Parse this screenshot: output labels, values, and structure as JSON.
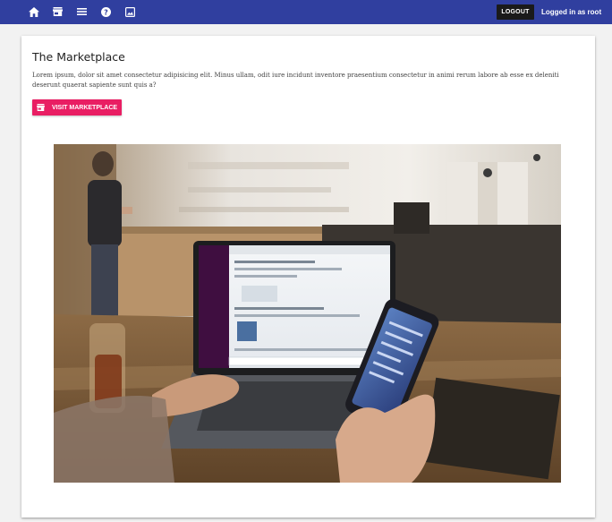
{
  "nav": {
    "icons": [
      "home-icon",
      "store-icon",
      "menu-icon",
      "help-icon",
      "image-icon"
    ],
    "logout_label": "LOGOUT",
    "logged_in_text": "Logged in as root"
  },
  "colors": {
    "topbar": "#303f9f",
    "accent": "#e91e63",
    "logout_bg": "#1a1a1a",
    "page_bg": "#f2f2f2"
  },
  "card": {
    "title": "The Marketplace",
    "body": "Lorem ipsum, dolor sit amet consectetur adipisicing elit. Minus ullam, odit iure incidunt inventore praesentium consectetur in animi rerum labore ab esse ex deleniti deserunt quaerat sapiente sunt quis a?",
    "button_label": "VISIT MARKETPLACE",
    "button_icon": "store-icon"
  }
}
